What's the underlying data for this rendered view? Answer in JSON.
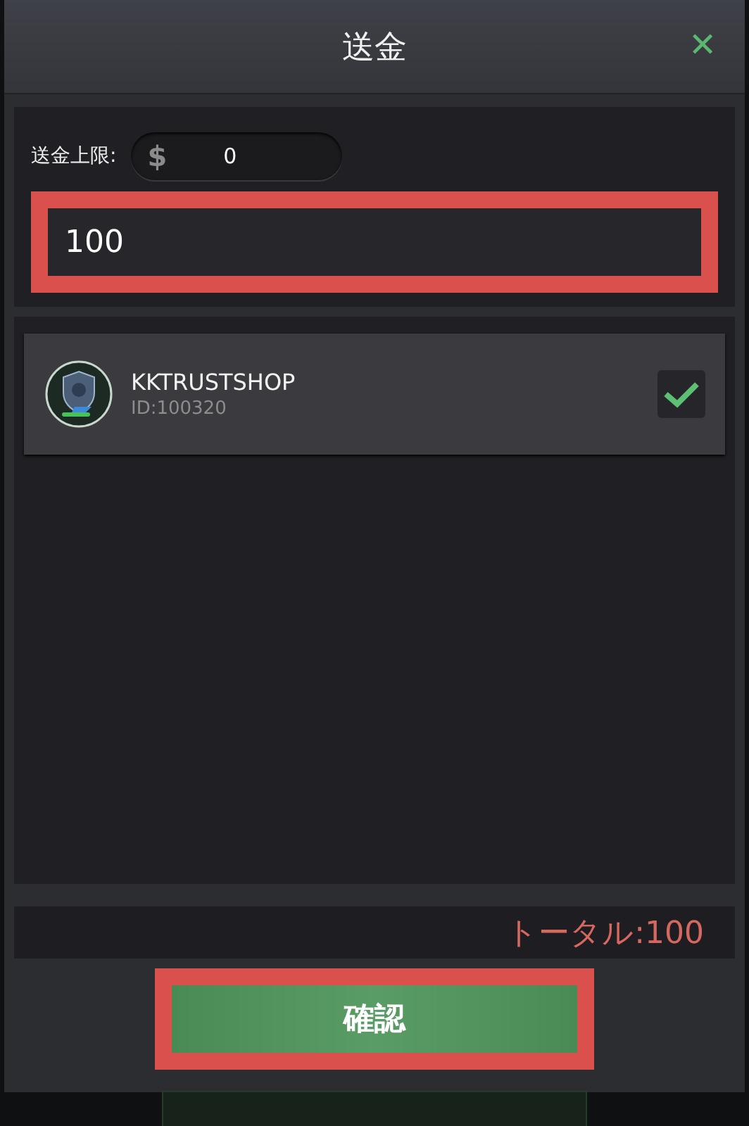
{
  "dialog": {
    "title": "送金",
    "close_icon": "✕"
  },
  "limit": {
    "label": "送金上限:",
    "currency": "$",
    "value": "0"
  },
  "amount": {
    "value": "100",
    "highlighted": true
  },
  "recipients": [
    {
      "name": "KKTRUSTSHOP",
      "id": "ID:100320",
      "checked": true
    }
  ],
  "total": "トータル:100",
  "confirm": {
    "label": "確認",
    "highlighted": true
  }
}
